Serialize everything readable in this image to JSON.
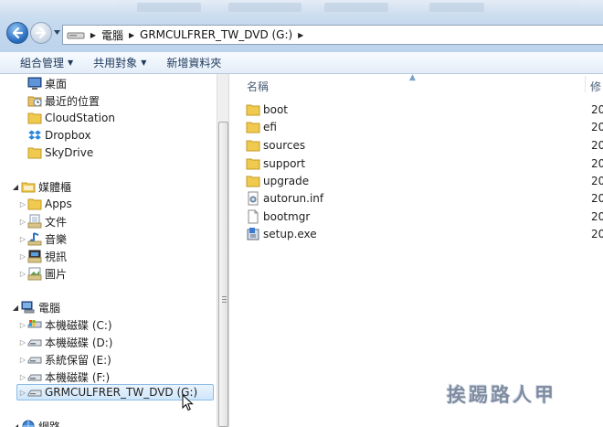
{
  "address_bar": {
    "breadcrumbs": [
      "電腦",
      "GRMCULFRER_TW_DVD (G:)"
    ]
  },
  "command_bar": {
    "organize": "組合管理",
    "share_with": "共用對象",
    "new_folder": "新增資料夾"
  },
  "nav_pane": {
    "favorites": [
      {
        "label": "桌面",
        "icon": "desktop-icon"
      },
      {
        "label": "最近的位置",
        "icon": "recent-places-icon"
      },
      {
        "label": "CloudStation",
        "icon": "folder-icon"
      },
      {
        "label": "Dropbox",
        "icon": "dropbox-icon"
      },
      {
        "label": "SkyDrive",
        "icon": "folder-icon"
      }
    ],
    "libraries": {
      "label": "媒體櫃",
      "items": [
        {
          "label": "Apps",
          "icon": "folder-icon"
        },
        {
          "label": "文件",
          "icon": "documents-library-icon"
        },
        {
          "label": "音樂",
          "icon": "music-library-icon"
        },
        {
          "label": "視訊",
          "icon": "video-library-icon"
        },
        {
          "label": "圖片",
          "icon": "pictures-library-icon"
        }
      ]
    },
    "computer": {
      "label": "電腦",
      "drives": [
        {
          "label": "本機磁碟 (C:)",
          "icon": "windows-drive-icon"
        },
        {
          "label": "本機磁碟 (D:)",
          "icon": "hard-drive-icon"
        },
        {
          "label": "系統保留 (E:)",
          "icon": "hard-drive-icon"
        },
        {
          "label": "本機磁碟 (F:)",
          "icon": "hard-drive-icon"
        },
        {
          "label": "GRMCULFRER_TW_DVD (G:)",
          "icon": "dvd-drive-icon",
          "selected": true
        }
      ]
    },
    "network": {
      "label": "網路"
    }
  },
  "content": {
    "column_name": "名稱",
    "column_date": "修",
    "files": [
      {
        "name": "boot",
        "date": "20",
        "icon": "folder-icon"
      },
      {
        "name": "efi",
        "date": "20",
        "icon": "folder-icon"
      },
      {
        "name": "sources",
        "date": "20",
        "icon": "folder-icon"
      },
      {
        "name": "support",
        "date": "20",
        "icon": "folder-icon"
      },
      {
        "name": "upgrade",
        "date": "20",
        "icon": "folder-icon"
      },
      {
        "name": "autorun.inf",
        "date": "20",
        "icon": "settings-file-icon"
      },
      {
        "name": "bootmgr",
        "date": "20",
        "icon": "file-icon"
      },
      {
        "name": "setup.exe",
        "date": "20",
        "icon": "setup-exe-icon"
      }
    ]
  },
  "watermark": "挨踢路人甲"
}
